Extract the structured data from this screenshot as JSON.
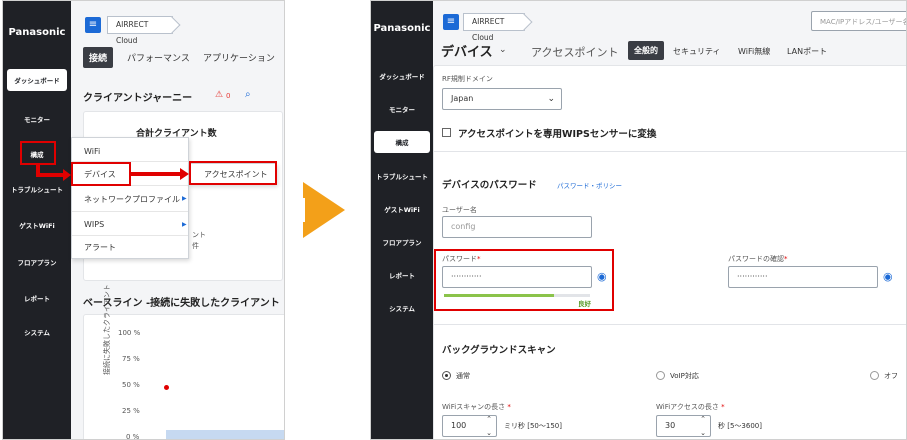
{
  "left": {
    "sidebar": {
      "logo": "Panasonic",
      "items": [
        "ダッシュボード",
        "モニター",
        "構成",
        "トラブルシュート",
        "ゲストWiFi",
        "フロアプラン",
        "レポート",
        "システム"
      ]
    },
    "breadcrumb": "AIRRECT Cloud",
    "tabs": [
      "接続",
      "パフォーマンス",
      "アプリケーション"
    ],
    "section_title": "クライアントジャーニー",
    "warning_count": "0",
    "card_title": "合計クライアント数",
    "card_partial_1": "ント",
    "card_partial_2": "件",
    "baseline_title": "ベースライン -接続に失敗したクライアント",
    "chart_data": {
      "type": "scatter",
      "title": "",
      "ylabel": "接続に失敗したクライアント",
      "yticks": [
        "100 %",
        "75 %",
        "50 %",
        "25 %",
        "0 %"
      ],
      "points": [
        {
          "y": 50
        }
      ],
      "ylim": [
        0,
        100
      ]
    },
    "menu": [
      "WiFi",
      "デバイス",
      "ネットワークプロファイル",
      "WIPS",
      "アラート"
    ],
    "submenu": "アクセスポイント"
  },
  "right": {
    "sidebar": {
      "logo": "Panasonic",
      "items": [
        "ダッシュボード",
        "モニター",
        "構成",
        "トラブルシュート",
        "ゲストWiFi",
        "フロアプラン",
        "レポート",
        "システム"
      ]
    },
    "breadcrumb": "AIRRECT Cloud",
    "search_placeholder": "MAC/IPアドレス/ユーザー名",
    "page_title": "デバイス",
    "page_subtitle": "アクセスポイント",
    "tabs": [
      "全般的",
      "セキュリティ",
      "WiFi無線",
      "LANポート"
    ],
    "rf_label": "RF規制ドメイン",
    "rf_value": "Japan",
    "wips_checkbox_label": "アクセスポイントを専用WIPSセンサーに変換",
    "password_section": "デバイスのパスワード",
    "password_policy_link": "パスワード・ポリシー",
    "username_label": "ユーザー名",
    "username_placeholder": "config",
    "password_label": "パスワード",
    "password_value": "············",
    "confirm_label": "パスワードの確認",
    "confirm_value": "············",
    "strength_text": "良好",
    "strength_level": 0.75,
    "required_mark": "*",
    "bg_scan_title": "バックグラウンドスキャン",
    "radio_options": [
      "通常",
      "VoIP対応",
      "オフ"
    ],
    "wifi_scan_label": "WiFiスキャンの長さ",
    "wifi_scan_value": "100",
    "wifi_scan_unit": "ミリ秒 [50〜150]",
    "wifi_access_label": "WiFiアクセスの長さ",
    "wifi_access_value": "30",
    "wifi_access_unit": "秒 [5〜3600]"
  },
  "colors": {
    "accent": "#1c6ad6",
    "highlight_red": "#e00000",
    "arrow_orange": "#f3a019",
    "strength_green": "#8bc34a"
  }
}
